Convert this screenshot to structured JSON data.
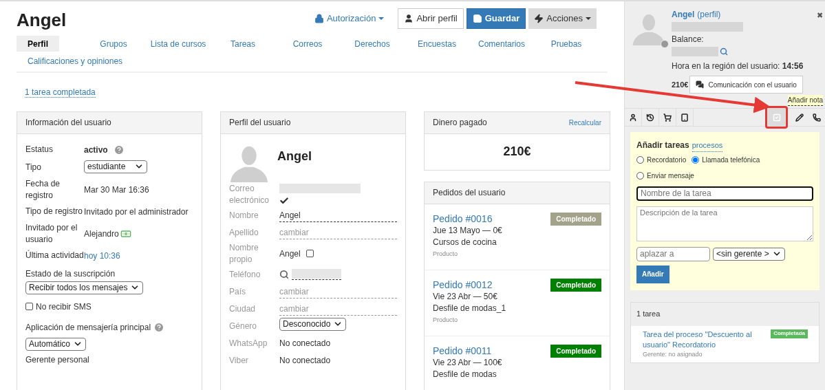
{
  "header": {
    "title": "Angel",
    "buttons": [
      {
        "kind": "link-dropdown",
        "label": "Autorización"
      },
      {
        "kind": "default",
        "label": "Abrir perfil"
      },
      {
        "kind": "primary",
        "label": "Guardar"
      },
      {
        "kind": "dropdown",
        "label": "Acciones"
      }
    ]
  },
  "tabs": [
    {
      "label": "Perfil",
      "selected": true
    },
    {
      "label": "Grupos",
      "selected": false
    },
    {
      "label": "Lista de cursos",
      "selected": false
    },
    {
      "label": "Tareas",
      "selected": false
    },
    {
      "label": "Correos",
      "selected": false
    },
    {
      "label": "Derechos",
      "selected": false
    },
    {
      "label": "Encuestas",
      "selected": false
    },
    {
      "label": "Comentarios",
      "selected": false
    },
    {
      "label": "Pruebas",
      "selected": false
    },
    {
      "label": "Calificaciones y opiniones",
      "selected": false
    }
  ],
  "completed_link": "1 tarea completada",
  "user_info": {
    "title": "Información del usuario",
    "rows": [
      {
        "kind": "bold-help",
        "label": "Estatus",
        "value": "activo"
      },
      {
        "kind": "select",
        "label": "Tipo",
        "value": "estudiante"
      },
      {
        "kind": "text",
        "label": "Fecha de registro",
        "value": "Mar 30 Mar 16:36"
      },
      {
        "kind": "text",
        "label": "Tipo de registro",
        "value": "Invitado por el administrador"
      },
      {
        "kind": "text-money",
        "label": "Invitado por el usuario",
        "value": "Alejandro"
      },
      {
        "kind": "link",
        "label": "Última actividad",
        "value": "hoy 10:36"
      }
    ],
    "subscription_label": "Estado de la suscripción",
    "subscription_value": "Recibir todos los mensajes",
    "no_sms": {
      "label": "No recibir SMS",
      "checked": false
    },
    "messenger_label": "Aplicación de mensajería principal",
    "messenger_value": "Automático",
    "manager_label": "Gerente personal"
  },
  "profile": {
    "title": "Perfil del usuario",
    "name": "Angel",
    "rows": [
      {
        "kind": "redacted-check",
        "label": "Correo electrónico"
      },
      {
        "kind": "underlined",
        "label": "Nombre",
        "value": "Angel"
      },
      {
        "kind": "change",
        "label": "Apellido",
        "value": "cambiar"
      },
      {
        "kind": "text-checkbox",
        "label": "Nombre propio",
        "value": "Angel",
        "checked": false
      },
      {
        "kind": "phone",
        "label": "Teléfono"
      },
      {
        "kind": "change",
        "label": "País",
        "value": "cambiar"
      },
      {
        "kind": "change",
        "label": "Ciudad",
        "value": "cambiar"
      },
      {
        "kind": "select",
        "label": "Género",
        "value": "Desconocido"
      },
      {
        "kind": "text",
        "label": "WhatsApp",
        "value": "No conectado"
      },
      {
        "kind": "text",
        "label": "Viber",
        "value": "No conectado"
      }
    ]
  },
  "money": {
    "title": "Dinero pagado",
    "action": "Recalcular",
    "amount": "210€"
  },
  "orders": {
    "title": "Pedidos del usuario",
    "items": [
      {
        "title": "Pedido #0016",
        "date": "Jue 13 Mayo — 0€",
        "product": "Cursos de cocina",
        "type": "Producto",
        "status": "Completado",
        "color": "#a3a38c"
      },
      {
        "title": "Pedido #0012",
        "date": "Vie 23 Abr — 50€",
        "product": "Desfile de modas_1",
        "type": "Producto",
        "status": "Completado",
        "color": "#008000"
      },
      {
        "title": "Pedido #0011",
        "date": "Vie 23 Abr — 100€",
        "product": "Desfile de modas",
        "status": "Completado",
        "color": "#008000"
      }
    ]
  },
  "panel": {
    "close": "✖",
    "name": "Angel",
    "profile_link": "(perfil)",
    "balance_label": "Balance:",
    "time": "Hora en la región del usuario: **14:56**",
    "amount": "210€",
    "chat_button": "Comunicación con el usuario",
    "note_link": "Añadir nota",
    "toolbar": [
      {
        "selected": false
      },
      {
        "selected": false
      },
      {
        "selected": false
      },
      {
        "selected": false
      },
      {
        "selected": true
      },
      {
        "selected": false
      },
      {
        "selected": false
      }
    ],
    "form": {
      "title": "Añadir tareas",
      "processes": "procesos",
      "types": [
        {
          "label": "Recordatorio",
          "selected": false
        },
        {
          "label": "Llamada telefónica",
          "selected": true
        },
        {
          "label": "Enviar mensaje",
          "selected": false
        }
      ],
      "name_placeholder": "Nombre de la tarea",
      "description_placeholder": "Descripción de la tarea",
      "postpone_placeholder": "aplazar a",
      "manager": "<sin gerente >",
      "submit": "Añadir"
    },
    "tasks": {
      "count": "1 tarea",
      "items": [
        {
          "title": "Tarea del proceso \"Descuento al usuario\" Recordatorio",
          "status": "Completada",
          "manager": "Gerente: no asignado"
        }
      ]
    }
  }
}
